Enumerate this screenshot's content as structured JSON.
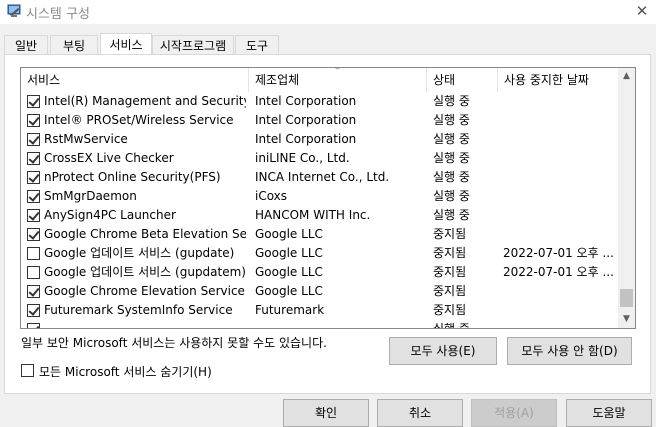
{
  "window": {
    "title": "시스템 구성",
    "close_glyph": "✕"
  },
  "tabs": [
    {
      "label": "일반"
    },
    {
      "label": "부팅"
    },
    {
      "label": "서비스"
    },
    {
      "label": "시작프로그램"
    },
    {
      "label": "도구"
    }
  ],
  "services": {
    "columns": {
      "service": "서비스",
      "manufacturer": "제조업체",
      "status": "상태",
      "date_disabled": "사용 중지한 날짜"
    },
    "rows": [
      {
        "checked": true,
        "service": "Intel(R) Management and Security ...",
        "manufacturer": "Intel Corporation",
        "status": "실행 중",
        "date": ""
      },
      {
        "checked": true,
        "service": "Intel® PROSet/Wireless Service",
        "manufacturer": "Intel Corporation",
        "status": "실행 중",
        "date": ""
      },
      {
        "checked": true,
        "service": "RstMwService",
        "manufacturer": "Intel Corporation",
        "status": "실행 중",
        "date": ""
      },
      {
        "checked": true,
        "service": "CrossEX Live Checker",
        "manufacturer": "iniLINE Co., Ltd.",
        "status": "실행 중",
        "date": ""
      },
      {
        "checked": true,
        "service": "nProtect Online Security(PFS)",
        "manufacturer": "INCA Internet Co., Ltd.",
        "status": "실행 중",
        "date": ""
      },
      {
        "checked": true,
        "service": "SmMgrDaemon",
        "manufacturer": "iCoxs",
        "status": "실행 중",
        "date": ""
      },
      {
        "checked": true,
        "service": "AnySign4PC Launcher",
        "manufacturer": "HANCOM WITH Inc.",
        "status": "실행 중",
        "date": ""
      },
      {
        "checked": true,
        "service": "Google Chrome Beta Elevation Serv...",
        "manufacturer": "Google LLC",
        "status": "중지됨",
        "date": ""
      },
      {
        "checked": false,
        "service": "Google 업데이트 서비스 (gupdate)",
        "manufacturer": "Google LLC",
        "status": "중지됨",
        "date": "2022-07-01 오후 ..."
      },
      {
        "checked": false,
        "service": "Google 업데이트 서비스 (gupdatem)",
        "manufacturer": "Google LLC",
        "status": "중지됨",
        "date": "2022-07-01 오후 ..."
      },
      {
        "checked": true,
        "service": "Google Chrome Elevation Service (...",
        "manufacturer": "Google LLC",
        "status": "중지됨",
        "date": ""
      },
      {
        "checked": true,
        "service": "Futuremark SystemInfo Service",
        "manufacturer": "Futuremark",
        "status": "중지됨",
        "date": ""
      },
      {
        "checked": true,
        "service": "",
        "manufacturer": "",
        "status": "실행 중",
        "date": ""
      }
    ]
  },
  "warning_text": "일부 보안 Microsoft 서비스는 사용하지 못할 수도 있습니다.",
  "enable_all_label": "모두 사용(E)",
  "disable_all_label": "모두 사용 안 함(D)",
  "hide_microsoft": {
    "label": "모든 Microsoft 서비스 숨기기(H)",
    "checked": false
  },
  "buttons": {
    "ok": "확인",
    "cancel": "취소",
    "apply": "적용(A)",
    "help": "도움말"
  }
}
